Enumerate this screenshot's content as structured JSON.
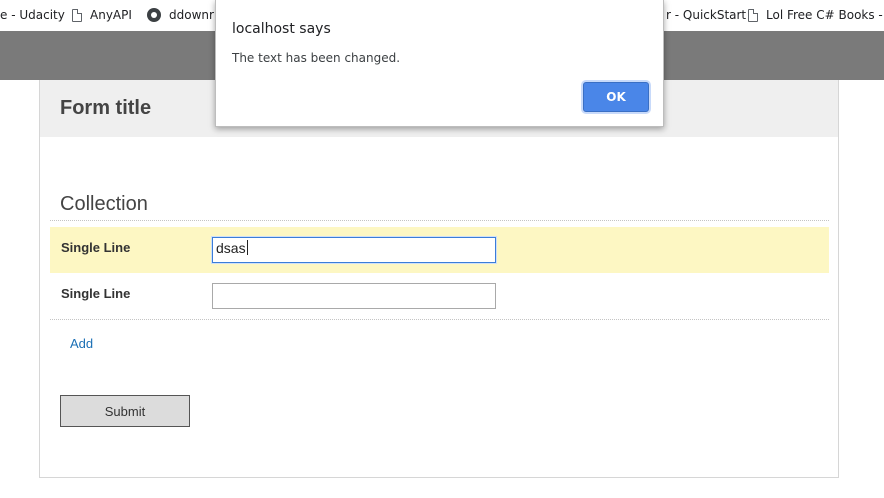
{
  "bookmarks": [
    {
      "label": "e - Udacity",
      "icon": "none"
    },
    {
      "label": "AnyAPI",
      "icon": "doc-icon"
    },
    {
      "label": "ddownr",
      "icon": "github-icon"
    },
    {
      "label": "r - QuickStart",
      "icon": "none"
    },
    {
      "label": "Lol Free C# Books - I",
      "icon": "doc-icon"
    }
  ],
  "form": {
    "title": "Form title",
    "section_title": "Collection",
    "rows": [
      {
        "label": "Single Line",
        "value": "dsas",
        "highlighted": true,
        "focused": true
      },
      {
        "label": "Single Line",
        "value": "",
        "highlighted": false,
        "focused": false
      }
    ],
    "add_label": "Add",
    "submit_label": "Submit"
  },
  "dialog": {
    "title": "localhost says",
    "message": "The text has been changed.",
    "ok_label": "OK"
  },
  "colors": {
    "highlight_row": "#fdf7c3",
    "link": "#1a6fb5",
    "ok_button": "#4a86e8",
    "page_band": "#7a7a7a"
  }
}
